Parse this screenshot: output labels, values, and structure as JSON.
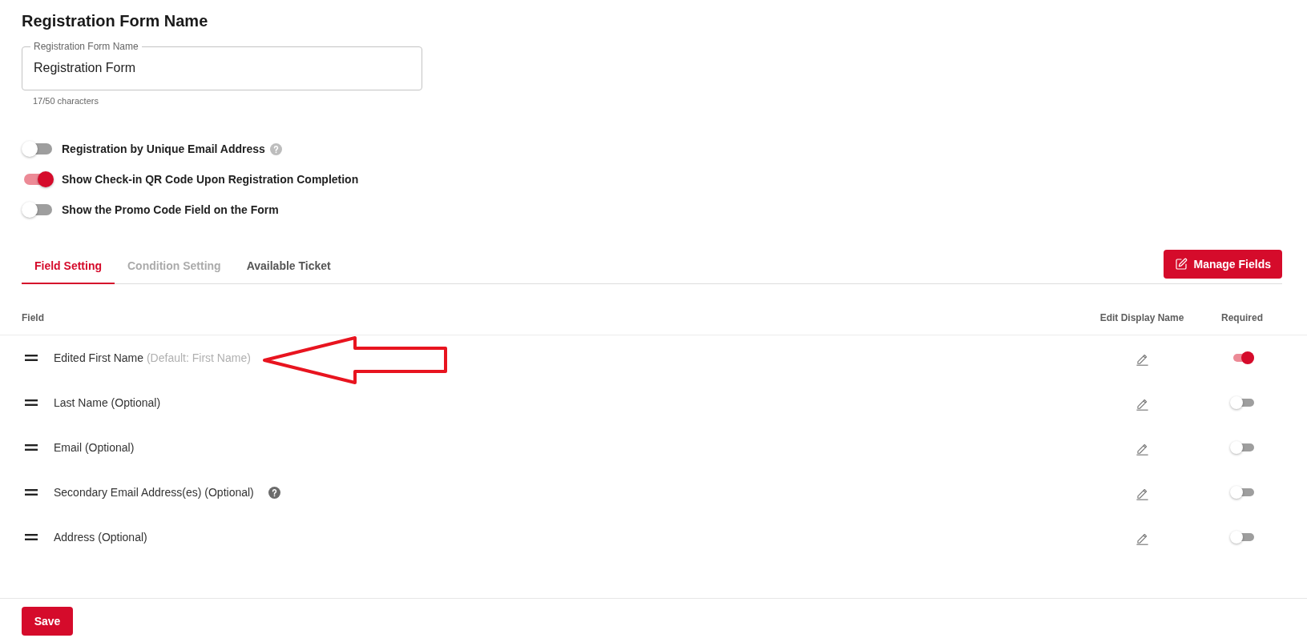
{
  "page": {
    "title": "Registration Form Name"
  },
  "form_name_field": {
    "label": "Registration Form Name",
    "value": "Registration Form",
    "helper": "17/50 characters"
  },
  "toggles": [
    {
      "label": "Registration by Unique Email Address",
      "on": false,
      "hint_icon": true
    },
    {
      "label": "Show Check-in QR Code Upon Registration Completion",
      "on": true,
      "hint_icon": false
    },
    {
      "label": "Show the Promo Code Field on the Form",
      "on": false,
      "hint_icon": false
    }
  ],
  "tabs": [
    {
      "label": "Field Setting",
      "selected": true,
      "disabled": false
    },
    {
      "label": "Condition Setting",
      "selected": false,
      "disabled": true
    },
    {
      "label": "Available Ticket",
      "selected": false,
      "disabled": false
    }
  ],
  "manage_button": {
    "label": "Manage Fields"
  },
  "table": {
    "columns": [
      "Field",
      "Edit Display Name",
      "Required"
    ],
    "rows": [
      {
        "label": "Edited First Name",
        "default_note": "(Default: First Name)",
        "hint_icon": false,
        "required": true,
        "arrow_annotation": true
      },
      {
        "label": "Last Name (Optional)",
        "hint_icon": false,
        "required": false,
        "arrow_annotation": false
      },
      {
        "label": "Email (Optional)",
        "hint_icon": false,
        "required": false,
        "arrow_annotation": false
      },
      {
        "label": "Secondary Email Address(es) (Optional)",
        "hint_icon": true,
        "required": false,
        "arrow_annotation": false
      },
      {
        "label": "Address (Optional)",
        "hint_icon": false,
        "required": false,
        "arrow_annotation": false
      }
    ]
  },
  "save_button": {
    "label": "Save"
  }
}
